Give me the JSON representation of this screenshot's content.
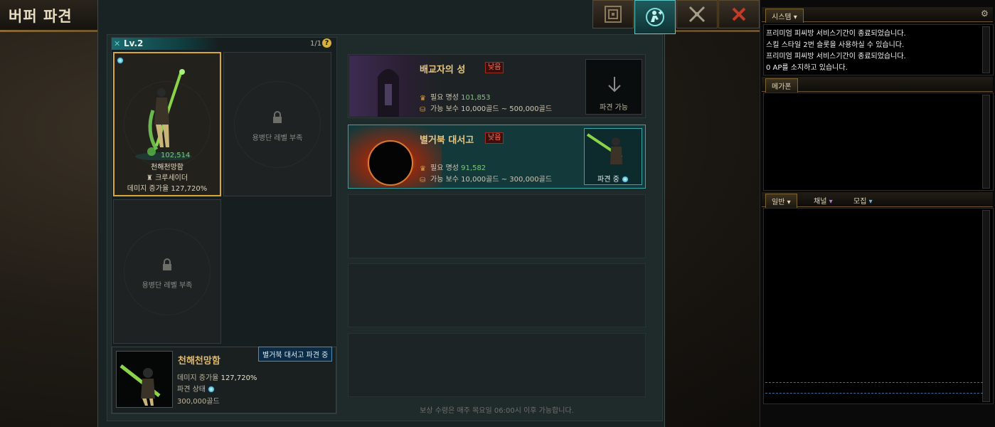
{
  "page_title": "버퍼 파견",
  "top_buttons": [
    {
      "name": "map-icon"
    },
    {
      "name": "buffer-dispatch-icon"
    },
    {
      "name": "crossed-swords-icon"
    },
    {
      "name": "close-icon"
    }
  ],
  "roster": {
    "level": "Lv.2",
    "page": "1/1",
    "help": "?",
    "selected_character": {
      "fame": "102,514",
      "name": "천해천망함",
      "class": "크루세이더",
      "damage_label": "데미지 증가율",
      "damage_value": "127,720%"
    },
    "locked_slot_text": "용병단 레벨 부족"
  },
  "detail": {
    "tooltip": "별거북 대서고 파견 중",
    "name": "천해천망함",
    "damage_label": "데미지 증가율",
    "damage_value": "127,720%",
    "status_label": "파견 상태",
    "reward": "300,000골드"
  },
  "dungeons": [
    {
      "name": "배교자의 성",
      "badge": "낮음",
      "fame_label": "필요 명성",
      "fame_value": "101,853",
      "reward_label": "가능 보수",
      "reward_value": "10,000골드 ~ 500,000골드",
      "action": "파견 가능"
    },
    {
      "name": "별거북 대서고",
      "badge": "낮음",
      "fame_label": "필요 명성",
      "fame_value": "91,582",
      "reward_label": "가능 보수",
      "reward_value": "10,000골드 ~ 300,000골드",
      "action": "파견 중"
    }
  ],
  "footer_note": "보상 수령은 매주 목요일 06:00시 이후 가능합니다.",
  "chat": {
    "system_tab": "시스템",
    "system_lines": [
      "프리미엄 피씨방 서비스기간이 종료되었습니다.",
      "스킬 스타일 2번 슬롯을 사용하실 수 있습니다.",
      "프리미엄 피씨방 서비스기간이 종료되었습니다.",
      "0 AP를 소지하고 있습니다."
    ],
    "megaphone_tab": "메가폰",
    "tabs": [
      "일반",
      "채널",
      "모집"
    ]
  },
  "colors": {
    "accent_teal": "#3aa5a6",
    "gold_text": "#e5c583",
    "fame_green": "#7ec87a",
    "badge_red": "#ff6f5c"
  }
}
